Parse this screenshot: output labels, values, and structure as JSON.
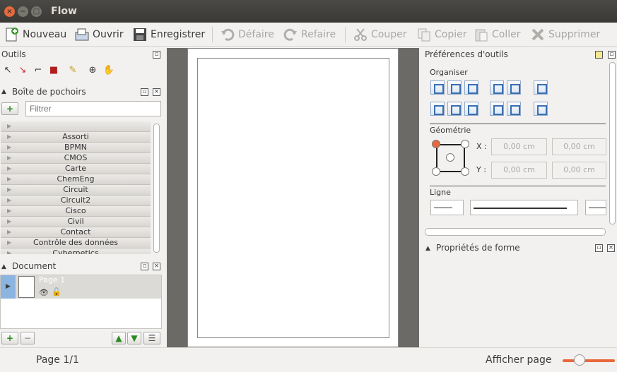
{
  "window": {
    "title": "Flow",
    "close": "×",
    "minimize": "−",
    "maximize": "□"
  },
  "toolbar": {
    "nouveau": "Nouveau",
    "ouvrir": "Ouvrir",
    "enregistrer": "Enregistrer",
    "defaire": "Défaire",
    "refaire": "Refaire",
    "couper": "Couper",
    "copier": "Copier",
    "coller": "Coller",
    "supprimer": "Supprimer"
  },
  "outils": {
    "title": "Outils"
  },
  "stencils": {
    "title": "Boîte de pochoirs",
    "filter_placeholder": "Filtrer",
    "items": [
      "",
      "Assorti",
      "BPMN",
      "CMOS",
      "Carte",
      "ChemEng",
      "Circuit",
      "Circuit2",
      "Cisco",
      "Civil",
      "Contact",
      "Contrôle des données",
      "Cybernetics"
    ]
  },
  "document": {
    "title": "Document",
    "page_label": "Page  1"
  },
  "prefs": {
    "title": "Préférences d'outils",
    "organiser": "Organiser",
    "geometrie": "Géométrie",
    "x_label": "X :",
    "y_label": "Y :",
    "x_value": "0,00 cm",
    "w_value": "0,00 cm",
    "y_value": "0,00 cm",
    "h_value": "0,00 cm",
    "ligne": "Ligne"
  },
  "shape_props": {
    "title": "Propriétés de forme"
  },
  "status": {
    "page": "Page 1/1",
    "afficher": "Afficher page"
  }
}
